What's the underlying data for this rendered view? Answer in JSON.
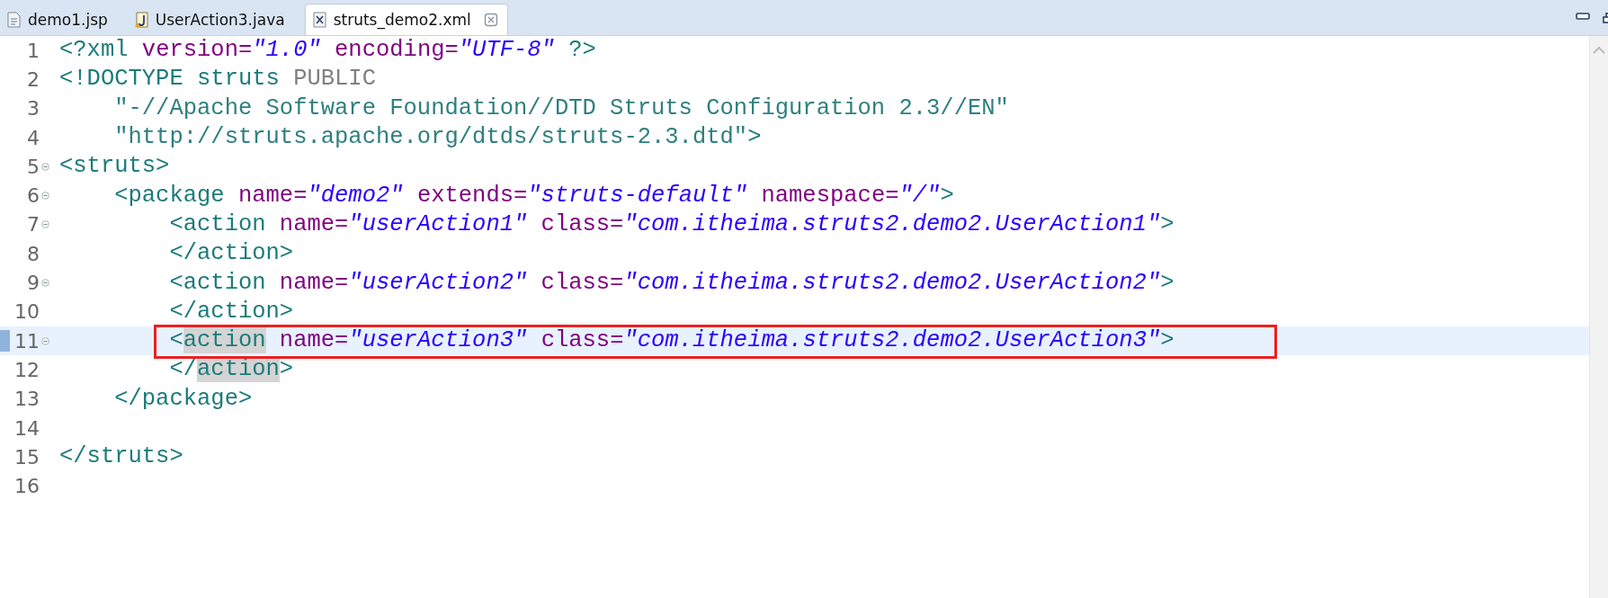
{
  "tabs": [
    {
      "label": "demo1.jsp",
      "kind": "jsp",
      "selected": false
    },
    {
      "label": "UserAction3.java",
      "kind": "java",
      "selected": false
    },
    {
      "label": "struts_demo2.xml",
      "kind": "xml",
      "selected": true
    }
  ],
  "editor": {
    "lines": [
      {
        "number": "1",
        "foldable": false,
        "current": false,
        "boxed": false,
        "tokens": [
          {
            "kind": "tag",
            "text": "<?xml "
          },
          {
            "kind": "attr",
            "text": "version="
          },
          {
            "kind": "value",
            "text": "\"1.0\""
          },
          {
            "kind": "attr",
            "text": " encoding="
          },
          {
            "kind": "value",
            "text": "\"UTF-8\""
          },
          {
            "kind": "tag",
            "text": " ?>"
          }
        ]
      },
      {
        "number": "2",
        "foldable": false,
        "current": false,
        "boxed": false,
        "tokens": [
          {
            "kind": "tag",
            "text": "<!DOCTYPE struts "
          },
          {
            "kind": "keyword",
            "text": "PUBLIC"
          }
        ]
      },
      {
        "number": "3",
        "foldable": false,
        "current": false,
        "boxed": false,
        "tokens": [
          {
            "kind": "string",
            "text": "    \"-//Apache Software Foundation//DTD Struts Configuration 2.3//EN\""
          }
        ]
      },
      {
        "number": "4",
        "foldable": false,
        "current": false,
        "boxed": false,
        "tokens": [
          {
            "kind": "string",
            "text": "    \"http://struts.apache.org/dtds/struts-2.3.dtd\""
          },
          {
            "kind": "tag",
            "text": ">"
          }
        ]
      },
      {
        "number": "5",
        "foldable": true,
        "current": false,
        "boxed": false,
        "tokens": [
          {
            "kind": "tag",
            "text": "<struts>"
          }
        ]
      },
      {
        "number": "6",
        "foldable": true,
        "current": false,
        "boxed": false,
        "tokens": [
          {
            "kind": "tag",
            "text": "    <package "
          },
          {
            "kind": "attr",
            "text": "name="
          },
          {
            "kind": "value",
            "text": "\"demo2\""
          },
          {
            "kind": "attr",
            "text": " extends="
          },
          {
            "kind": "value",
            "text": "\"struts-default\""
          },
          {
            "kind": "attr",
            "text": " namespace="
          },
          {
            "kind": "value",
            "text": "\"/\""
          },
          {
            "kind": "tag",
            "text": ">"
          }
        ]
      },
      {
        "number": "7",
        "foldable": true,
        "current": false,
        "boxed": false,
        "tokens": [
          {
            "kind": "tag",
            "text": "        <action "
          },
          {
            "kind": "attr",
            "text": "name="
          },
          {
            "kind": "value",
            "text": "\"userAction1\""
          },
          {
            "kind": "attr",
            "text": " class="
          },
          {
            "kind": "value",
            "text": "\"com.itheima.struts2.demo2.UserAction1\""
          },
          {
            "kind": "tag",
            "text": ">"
          }
        ]
      },
      {
        "number": "8",
        "foldable": false,
        "current": false,
        "boxed": false,
        "tokens": [
          {
            "kind": "tag",
            "text": "        </action>"
          }
        ]
      },
      {
        "number": "9",
        "foldable": true,
        "current": false,
        "boxed": false,
        "tokens": [
          {
            "kind": "tag",
            "text": "        <action "
          },
          {
            "kind": "attr",
            "text": "name="
          },
          {
            "kind": "value",
            "text": "\"userAction2\""
          },
          {
            "kind": "attr",
            "text": " class="
          },
          {
            "kind": "value",
            "text": "\"com.itheima.struts2.demo2.UserAction2\""
          },
          {
            "kind": "tag",
            "text": ">"
          }
        ]
      },
      {
        "number": "10",
        "foldable": false,
        "current": false,
        "boxed": false,
        "tokens": [
          {
            "kind": "tag",
            "text": "        </action>"
          }
        ]
      },
      {
        "number": "11",
        "foldable": true,
        "current": true,
        "boxed": true,
        "tokens": [
          {
            "kind": "tag",
            "text": "        <"
          },
          {
            "kind": "occurrence",
            "text": "action"
          },
          {
            "kind": "attr",
            "text": " name="
          },
          {
            "kind": "value",
            "text": "\"userAction3\""
          },
          {
            "kind": "attr",
            "text": " class="
          },
          {
            "kind": "value",
            "text": "\"com.itheima.struts2.demo2.UserAction3\""
          },
          {
            "kind": "tag",
            "text": ">"
          }
        ]
      },
      {
        "number": "12",
        "foldable": false,
        "current": false,
        "boxed": false,
        "tokens": [
          {
            "kind": "tag",
            "text": "        </"
          },
          {
            "kind": "occurrence",
            "text": "action"
          },
          {
            "kind": "tag",
            "text": ">"
          }
        ]
      },
      {
        "number": "13",
        "foldable": false,
        "current": false,
        "boxed": false,
        "tokens": [
          {
            "kind": "tag",
            "text": "    </package>"
          }
        ]
      },
      {
        "number": "14",
        "foldable": false,
        "current": false,
        "boxed": false
      },
      {
        "number": "15",
        "foldable": false,
        "current": false,
        "boxed": false,
        "tokens": [
          {
            "kind": "tag",
            "text": "</struts>"
          }
        ]
      },
      {
        "number": "16",
        "foldable": false,
        "current": false,
        "boxed": false
      }
    ]
  }
}
